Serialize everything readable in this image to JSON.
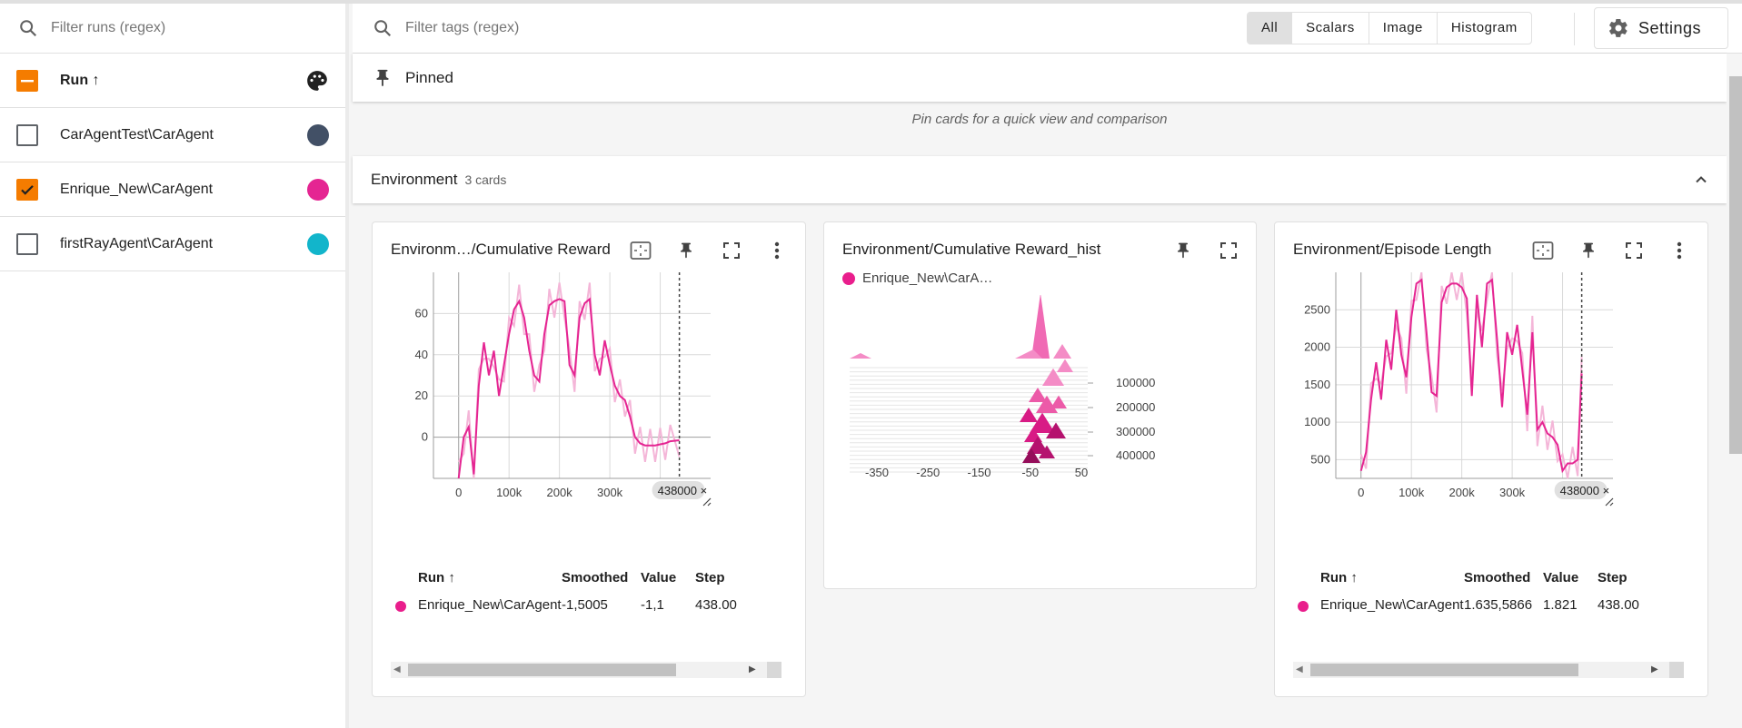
{
  "sidebar": {
    "search_placeholder": "Filter runs (regex)",
    "header_label": "Run ↑",
    "runs": [
      {
        "name": "CarAgentTest\\CarAgent",
        "checked": false,
        "color": "#425066"
      },
      {
        "name": "Enrique_New\\CarAgent",
        "checked": true,
        "color": "#e52592"
      },
      {
        "name": "firstRayAgent\\CarAgent",
        "checked": false,
        "color": "#12b5cb"
      }
    ]
  },
  "topbar": {
    "search_placeholder": "Filter tags (regex)",
    "filters": [
      "All",
      "Scalars",
      "Image",
      "Histogram"
    ],
    "active_filter": "All",
    "settings_label": "Settings"
  },
  "pinned": {
    "title": "Pinned",
    "hint": "Pin cards for a quick view and comparison"
  },
  "group": {
    "title": "Environment",
    "count": "3 cards"
  },
  "cards": {
    "reward": {
      "title": "Environm…/Cumulative Reward",
      "step_chip": "438000",
      "table": {
        "headers": [
          "Run ↑",
          "Smoothed",
          "Value",
          "Step"
        ],
        "row": {
          "run": "Enrique_New\\CarAgent",
          "smoothed": "-1,5005",
          "value": "-1,1",
          "step": "438.00"
        }
      }
    },
    "hist": {
      "title": "Environment/Cumulative Reward_hist",
      "legend": "Enrique_New\\CarA…"
    },
    "episode": {
      "title": "Environment/Episode Length",
      "step_chip": "438000",
      "table": {
        "headers": [
          "Run ↑",
          "Smoothed",
          "Value",
          "Step"
        ],
        "row": {
          "run": "Enrique_New\\CarAgent",
          "smoothed": "1.635,5866",
          "value": "1.821",
          "step": "438.00"
        }
      }
    }
  },
  "chart_data": [
    {
      "type": "line",
      "title": "Environm…/Cumulative Reward",
      "x_ticks": [
        "0",
        "100k",
        "200k",
        "300k",
        "4"
      ],
      "y_ticks": [
        "60",
        "40",
        "20",
        "0"
      ],
      "xlim": [
        -50000,
        500000
      ],
      "ylim": [
        -20,
        80
      ],
      "series": [
        {
          "name": "Enrique_New\\CarAgent",
          "x": [
            0,
            10000,
            20000,
            30000,
            40000,
            50000,
            60000,
            70000,
            80000,
            90000,
            100000,
            110000,
            120000,
            130000,
            140000,
            150000,
            160000,
            170000,
            180000,
            190000,
            200000,
            210000,
            220000,
            230000,
            240000,
            250000,
            260000,
            270000,
            280000,
            290000,
            300000,
            310000,
            320000,
            330000,
            340000,
            350000,
            360000,
            370000,
            380000,
            390000,
            400000,
            410000,
            420000,
            438000
          ],
          "y": [
            -20,
            0,
            5,
            -18,
            25,
            46,
            30,
            42,
            20,
            35,
            50,
            62,
            66,
            58,
            42,
            30,
            27,
            50,
            64,
            66,
            67,
            66,
            35,
            30,
            58,
            65,
            67,
            40,
            30,
            47,
            35,
            25,
            20,
            18,
            10,
            0,
            -3,
            -4,
            -4,
            -4,
            -3.5,
            -3,
            -2,
            -1.5
          ]
        }
      ]
    },
    {
      "type": "line",
      "title": "Environment/Episode Length",
      "x_ticks": [
        "0",
        "100k",
        "200k",
        "300k",
        "4"
      ],
      "y_ticks": [
        "2500",
        "2000",
        "1500",
        "1000",
        "500"
      ],
      "xlim": [
        -50000,
        500000
      ],
      "ylim": [
        250,
        3000
      ],
      "series": [
        {
          "name": "Enrique_New\\CarAgent",
          "x": [
            0,
            10000,
            20000,
            30000,
            40000,
            50000,
            60000,
            70000,
            80000,
            90000,
            100000,
            110000,
            120000,
            130000,
            140000,
            150000,
            160000,
            170000,
            180000,
            190000,
            200000,
            210000,
            220000,
            230000,
            240000,
            250000,
            260000,
            270000,
            280000,
            290000,
            300000,
            310000,
            320000,
            330000,
            340000,
            350000,
            360000,
            370000,
            380000,
            390000,
            400000,
            410000,
            420000,
            430000,
            438000
          ],
          "y": [
            350,
            600,
            1300,
            1800,
            1300,
            2100,
            1700,
            2500,
            1900,
            1600,
            2400,
            2850,
            2900,
            2200,
            1400,
            1350,
            2600,
            2800,
            2850,
            2850,
            2800,
            2650,
            1350,
            2700,
            2000,
            2850,
            2900,
            2100,
            1200,
            2200,
            1900,
            2300,
            1700,
            1100,
            2200,
            900,
            1000,
            850,
            800,
            700,
            350,
            450,
            450,
            500,
            1650
          ]
        }
      ]
    },
    {
      "type": "histogram",
      "title": "Environment/Cumulative Reward_hist",
      "x_ticks": [
        "-350",
        "-250",
        "-150",
        "-50",
        "50"
      ],
      "y_ticks": [
        "100000",
        "200000",
        "300000",
        "400000"
      ]
    }
  ]
}
